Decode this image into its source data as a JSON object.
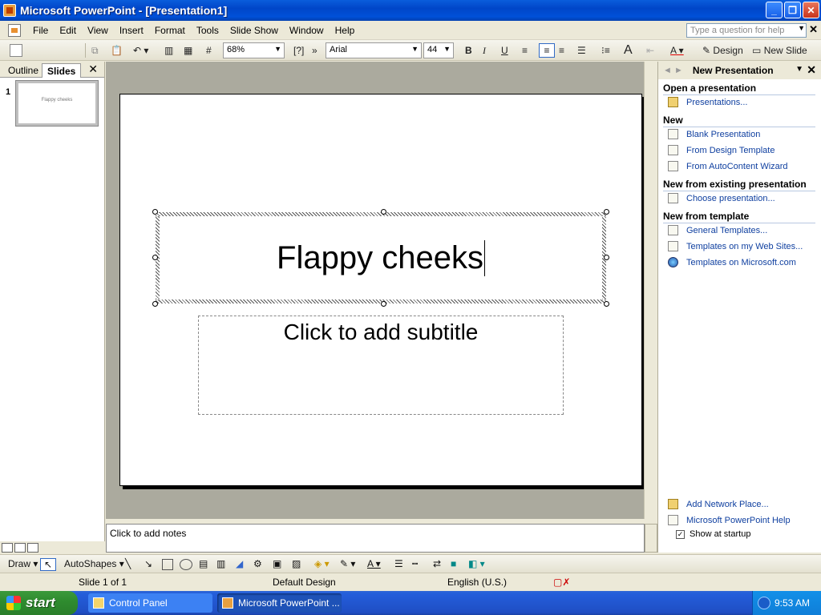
{
  "window": {
    "title": "Microsoft PowerPoint - [Presentation1]"
  },
  "menu": {
    "items": [
      "File",
      "Edit",
      "View",
      "Insert",
      "Format",
      "Tools",
      "Slide Show",
      "Window",
      "Help"
    ],
    "help_placeholder": "Type a question for help"
  },
  "toolbar": {
    "zoom": "68%",
    "font": "Arial",
    "font_size": "44",
    "design_label": "Design",
    "new_slide_label": "New Slide"
  },
  "left_pane": {
    "tabs": [
      "Outline",
      "Slides"
    ],
    "active_tab": "Slides",
    "slide_number": "1",
    "thumb_text": "Flappy cheeks"
  },
  "slide": {
    "title": "Flappy cheeks",
    "subtitle_placeholder": "Click to add subtitle"
  },
  "notes": {
    "placeholder": "Click to add notes"
  },
  "task_pane": {
    "title": "New Presentation",
    "sections": [
      {
        "heading": "Open a presentation",
        "links": [
          "Presentations..."
        ]
      },
      {
        "heading": "New",
        "links": [
          "Blank Presentation",
          "From Design Template",
          "From AutoContent Wizard"
        ]
      },
      {
        "heading": "New from existing presentation",
        "links": [
          "Choose presentation..."
        ]
      },
      {
        "heading": "New from template",
        "links": [
          "General Templates...",
          "Templates on my Web Sites...",
          "Templates on Microsoft.com"
        ]
      }
    ],
    "footer_links": [
      "Add Network Place...",
      "Microsoft PowerPoint Help"
    ],
    "show_at_startup": "Show at startup"
  },
  "draw_toolbar": {
    "draw_label": "Draw",
    "autoshapes_label": "AutoShapes"
  },
  "status": {
    "slide": "Slide 1 of 1",
    "design": "Default Design",
    "language": "English (U.S.)"
  },
  "taskbar": {
    "start_label": "start",
    "tasks": [
      "Control Panel",
      "Microsoft PowerPoint ..."
    ],
    "clock": "9:53 AM"
  }
}
